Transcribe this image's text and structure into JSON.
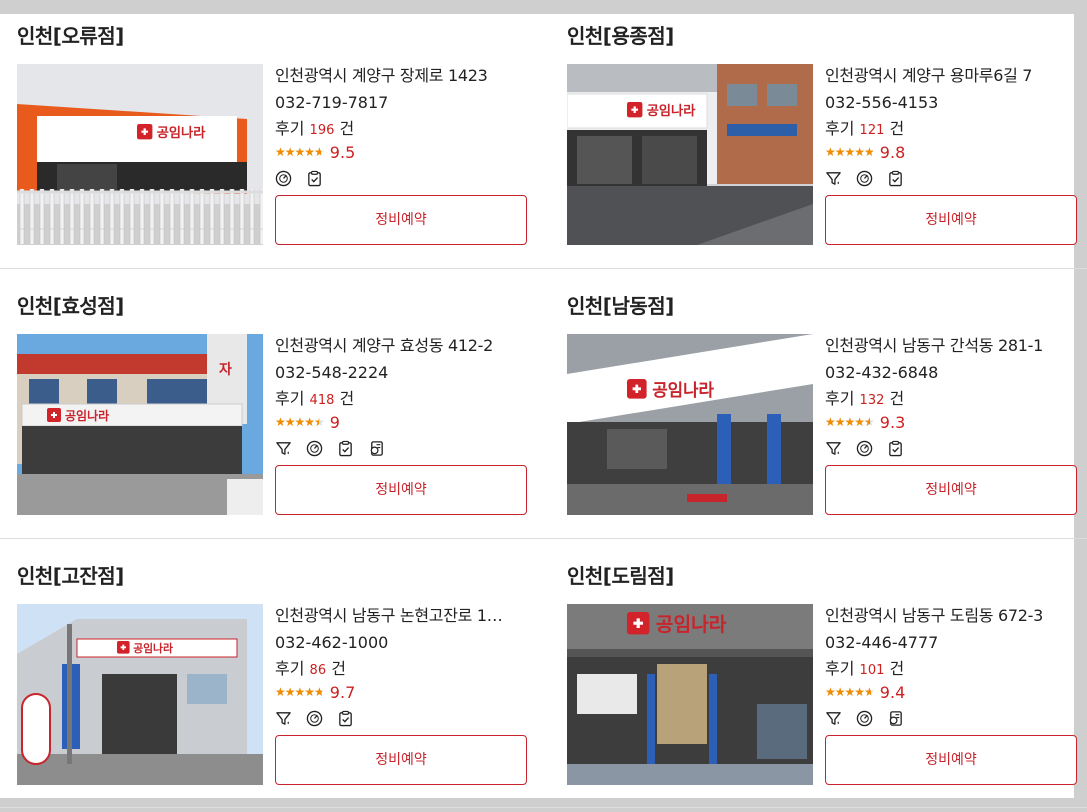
{
  "cards": [
    {
      "title": "인천[오류점]",
      "address": "인천광역시 계양구 장제로 1423",
      "phone": "032-719-7817",
      "review_label": "후기",
      "review_count": "196",
      "review_unit": "건",
      "rating": "9.5",
      "rating_fraction": 0.95,
      "icons": [
        "gauge-icon",
        "clipboard-check-icon"
      ],
      "button": "정비예약",
      "photo": {
        "scene": "orange-front",
        "sign": "공임나라"
      }
    },
    {
      "title": "인천[용종점]",
      "address": "인천광역시 계양구 용마루6길 7",
      "phone": "032-556-4153",
      "review_label": "후기",
      "review_count": "121",
      "review_unit": "건",
      "rating": "9.8",
      "rating_fraction": 0.98,
      "icons": [
        "oil-funnel-icon",
        "gauge-icon",
        "clipboard-check-icon"
      ],
      "button": "정비예약",
      "photo": {
        "scene": "street-building",
        "sign": "공임나라"
      }
    },
    {
      "title": "인천[효성점]",
      "address": "인천광역시 계양구 효성동 412-2",
      "phone": "032-548-2224",
      "review_label": "후기",
      "review_count": "418",
      "review_unit": "건",
      "rating": "9",
      "rating_fraction": 0.9,
      "icons": [
        "oil-funnel-icon",
        "gauge-icon",
        "clipboard-check-icon",
        "tire-document-icon"
      ],
      "button": "정비예약",
      "photo": {
        "scene": "striped-building",
        "sign": "공임나라"
      }
    },
    {
      "title": "인천[남동점]",
      "address": "인천광역시 남동구 간석동 281-1",
      "phone": "032-432-6848",
      "review_label": "후기",
      "review_count": "132",
      "review_unit": "건",
      "rating": "9.3",
      "rating_fraction": 0.93,
      "icons": [
        "oil-funnel-icon",
        "gauge-icon",
        "clipboard-check-icon"
      ],
      "button": "정비예약",
      "photo": {
        "scene": "garage-lifts",
        "sign": "공임나라"
      }
    },
    {
      "title": "인천[고잔점]",
      "address": "인천광역시 남동구 논현고잔로 1…",
      "phone": "032-462-1000",
      "review_label": "후기",
      "review_count": "86",
      "review_unit": "건",
      "rating": "9.7",
      "rating_fraction": 0.97,
      "icons": [
        "oil-funnel-icon",
        "gauge-icon",
        "clipboard-check-icon"
      ],
      "button": "정비예약",
      "photo": {
        "scene": "gray-warehouse",
        "sign": "공임나라"
      }
    },
    {
      "title": "인천[도림점]",
      "address": "인천광역시 남동구 도림동 672-3",
      "phone": "032-446-4777",
      "review_label": "후기",
      "review_count": "101",
      "review_unit": "건",
      "rating": "9.4",
      "rating_fraction": 0.94,
      "icons": [
        "oil-funnel-icon",
        "gauge-icon",
        "tire-document-icon"
      ],
      "button": "정비예약",
      "photo": {
        "scene": "dark-garage",
        "sign": "공임나라"
      }
    }
  ],
  "colors": {
    "accent": "#c8242c",
    "star": "#f08c00",
    "count": "#cc1f1f"
  }
}
